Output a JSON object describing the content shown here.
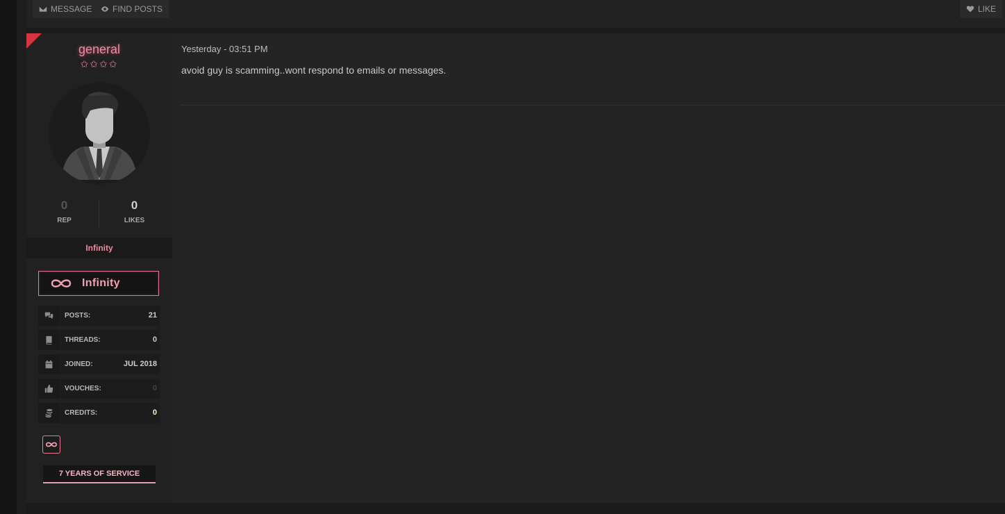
{
  "toolbar": {
    "message_label": "Message",
    "find_posts_label": "Find Posts",
    "like_label": "Like"
  },
  "colors": {
    "accent_pink": "#f08aa0",
    "corner_red": "#d8343f",
    "credits_highlight": "#fff2c8"
  },
  "author": {
    "username": "general",
    "stars": "✩✩✩✩",
    "rep_value": "0",
    "rep_label": "REP",
    "likes_value": "0",
    "likes_label": "LIKES",
    "group": "Infinity",
    "banner_text": "Infinity",
    "info": [
      {
        "icon": "comments-icon",
        "label": "POSTS:",
        "value": "21"
      },
      {
        "icon": "book-icon",
        "label": "THREADS:",
        "value": "0"
      },
      {
        "icon": "calendar-icon",
        "label": "JOINED:",
        "value": "JUL 2018"
      },
      {
        "icon": "thumbs-up-icon",
        "label": "VOUCHES:",
        "value": "0"
      },
      {
        "icon": "coins-icon",
        "label": "CREDITS:",
        "value": "0"
      }
    ],
    "service": "7 YEARS OF SERVICE"
  },
  "post": {
    "date": "Yesterday - 03:51 PM",
    "body": "avoid guy is scamming..wont respond to emails or messages."
  }
}
